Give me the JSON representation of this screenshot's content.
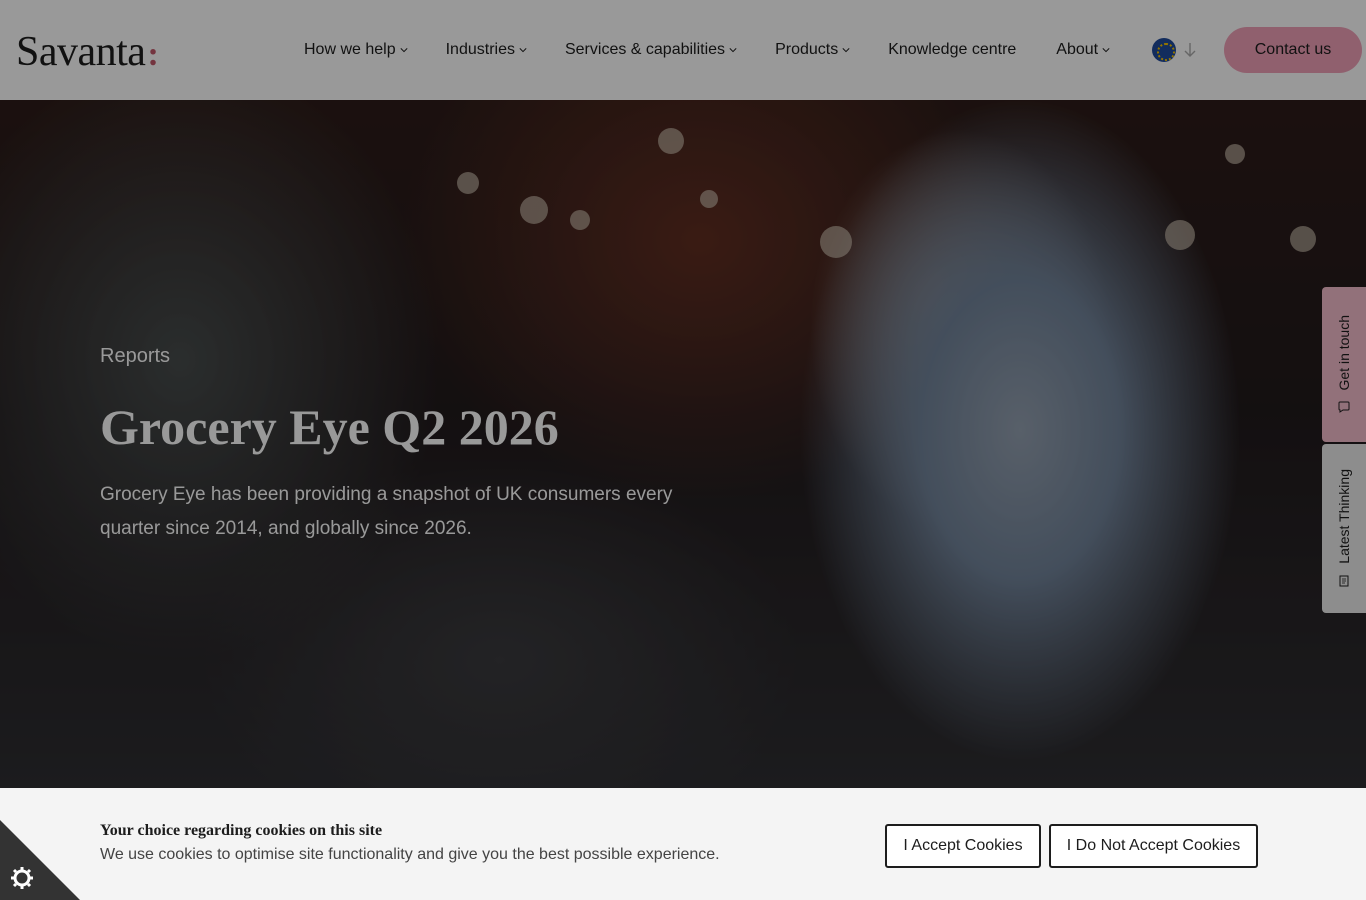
{
  "brand": {
    "name": "Savanta",
    "colon": ":"
  },
  "nav": {
    "items": [
      {
        "label": "How we help",
        "has_dropdown": true
      },
      {
        "label": "Industries",
        "has_dropdown": true
      },
      {
        "label": "Services & capabilities",
        "has_dropdown": true
      },
      {
        "label": "Products",
        "has_dropdown": true
      },
      {
        "label": "Knowledge centre",
        "has_dropdown": false
      },
      {
        "label": "About",
        "has_dropdown": true
      }
    ],
    "region_icon": "eu-flag-icon",
    "contact_label": "Contact us"
  },
  "hero": {
    "category": "Reports",
    "title": "Grocery Eye Q2 2026",
    "subtitle": "Grocery Eye has been providing a snapshot of UK consumers every quarter since 2014, and globally since 2026."
  },
  "side_tabs": {
    "get_in_touch": "Get in touch",
    "latest_thinking": "Latest Thinking"
  },
  "cookie": {
    "title": "Your choice regarding cookies on this site",
    "text": "We use cookies to optimise site functionality and give you the best possible experience.",
    "accept_label": "I Accept Cookies",
    "decline_label": "I Do Not Accept Cookies"
  },
  "colors": {
    "accent_pink": "#f0a0b8",
    "brand_colon": "#c2586a",
    "cookie_bg": "#f4f4f4"
  }
}
